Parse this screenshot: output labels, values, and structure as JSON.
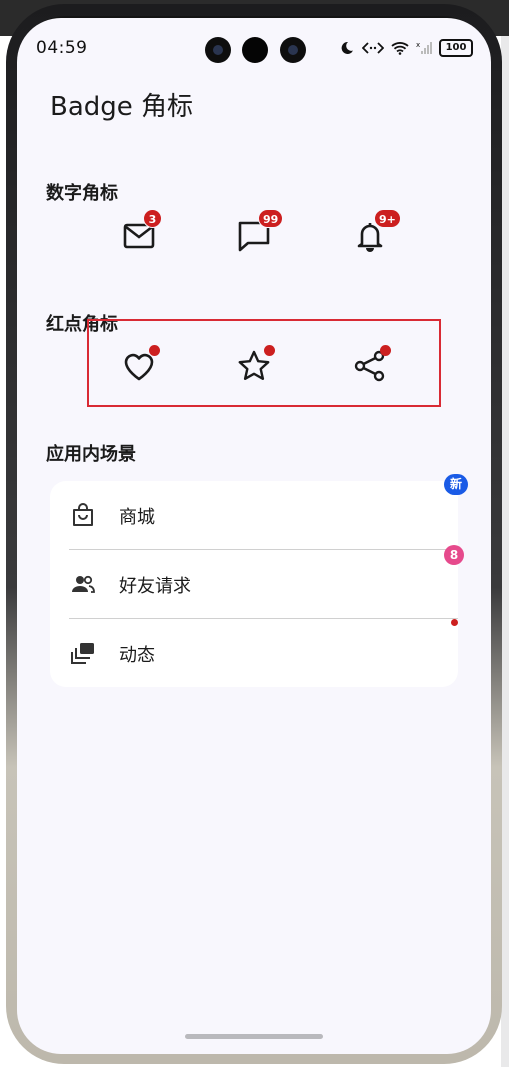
{
  "status_bar": {
    "time": "04:59",
    "battery": "100",
    "icons": [
      "moon-icon",
      "data-arrows-icon",
      "wifi-icon",
      "signal-icon",
      "battery-icon"
    ]
  },
  "page": {
    "title": "Badge 角标"
  },
  "number_badges": {
    "title": "数字角标",
    "items": [
      {
        "icon": "mail-icon",
        "badge": "3"
      },
      {
        "icon": "message-icon",
        "badge": "99"
      },
      {
        "icon": "bell-icon",
        "badge": "9+"
      }
    ]
  },
  "dot_badges": {
    "title": "红点角标",
    "items": [
      {
        "icon": "heart-icon"
      },
      {
        "icon": "star-icon"
      },
      {
        "icon": "share-icon"
      }
    ]
  },
  "scenes": {
    "title": "应用内场景",
    "items": [
      {
        "icon": "shopping-bag-icon",
        "label": "商城",
        "badge": "新"
      },
      {
        "icon": "friends-icon",
        "label": "好友请求",
        "badge": "8"
      },
      {
        "icon": "feed-icon",
        "label": "动态",
        "badge": ""
      }
    ]
  },
  "colors": {
    "badge_red": "#cc1f1f",
    "badge_blue": "#1a5be6",
    "badge_pink": "#e64a8c",
    "highlight_border": "#d92a34",
    "background": "#f8f7fd"
  }
}
